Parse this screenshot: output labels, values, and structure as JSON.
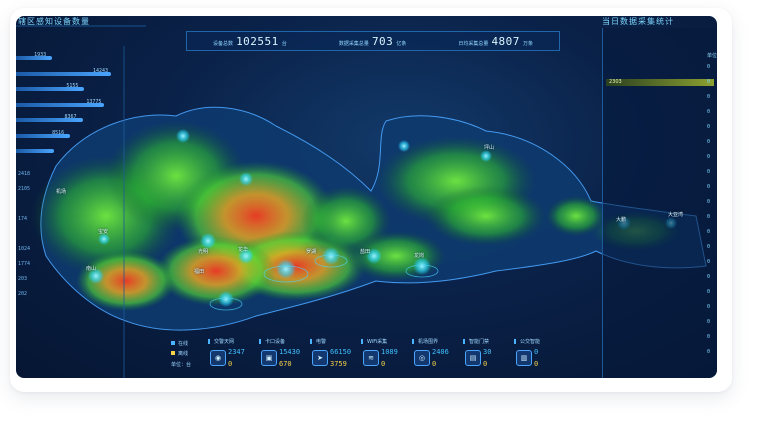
{
  "header": {
    "left_title": "辖区感知设备数量",
    "right_title": "当日数据采集统计"
  },
  "top_stats": [
    {
      "label": "设备总数",
      "value": "102551",
      "unit": "台"
    },
    {
      "label": "数据采集总量",
      "value": "703",
      "unit": "亿条"
    },
    {
      "label": "日均采集总量",
      "value": "4807",
      "unit": "万条"
    }
  ],
  "left_bars": [
    {
      "value": "1933",
      "fraction": 0.38
    },
    {
      "value": "14243",
      "fraction": 1.0
    },
    {
      "value": "5155",
      "fraction": 0.72
    },
    {
      "value": "13775",
      "fraction": 0.93
    },
    {
      "value": "8367",
      "fraction": 0.7
    },
    {
      "value": "8516",
      "fraction": 0.57
    },
    {
      "value": "",
      "fraction": 0.4
    }
  ],
  "left_numbers": [
    "2418",
    "2105",
    "",
    "174",
    "",
    "1024",
    "1774",
    "203",
    "202"
  ],
  "right_panel": {
    "header": "单位",
    "selected": "2303",
    "numbers": [
      "0",
      "0",
      "0",
      "0",
      "0",
      "0",
      "0",
      "0",
      "0",
      "0",
      "0",
      "0",
      "0",
      "0",
      "0",
      "0",
      "0",
      "0",
      "0",
      "0"
    ]
  },
  "legend": {
    "items": [
      {
        "label": "在线",
        "color": "#4ab4ff"
      },
      {
        "label": "离线",
        "color": "#f5d24a"
      }
    ],
    "unit": "单位：台"
  },
  "bottom_cards": [
    {
      "name": "交警天网",
      "icon": "camera-icon",
      "glyph": "◉",
      "v1": "2347",
      "v2": "0"
    },
    {
      "name": "卡口设备",
      "icon": "gate-icon",
      "glyph": "▣",
      "v1": "15430",
      "v2": "670"
    },
    {
      "name": "电警",
      "icon": "radar-icon",
      "glyph": "➤",
      "v1": "66150",
      "v2": "3759"
    },
    {
      "name": "WiFi采集",
      "icon": "wifi-icon",
      "glyph": "≋",
      "v1": "1089",
      "v2": "0"
    },
    {
      "name": "机场围界",
      "icon": "fence-icon",
      "glyph": "◎",
      "v1": "2406",
      "v2": "0"
    },
    {
      "name": "智能门禁",
      "icon": "door-icon",
      "glyph": "▤",
      "v1": "30",
      "v2": "0"
    },
    {
      "name": "公交智能",
      "icon": "bus-icon",
      "glyph": "▥",
      "v1": "0",
      "v2": "0"
    }
  ],
  "cities": [
    {
      "name": "机场"
    },
    {
      "name": "宝安"
    },
    {
      "name": "南山"
    },
    {
      "name": "福田"
    },
    {
      "name": "龙华"
    },
    {
      "name": "龙岗"
    },
    {
      "name": "坪山"
    },
    {
      "name": "大鹏"
    },
    {
      "name": "光明"
    },
    {
      "name": "罗湖"
    },
    {
      "name": "盐田"
    },
    {
      "name": "大亚湾"
    }
  ]
}
